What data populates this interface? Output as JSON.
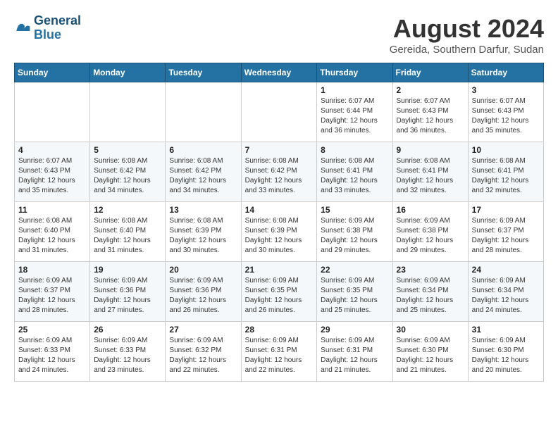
{
  "logo": {
    "line1": "General",
    "line2": "Blue"
  },
  "title": "August 2024",
  "location": "Gereida, Southern Darfur, Sudan",
  "weekdays": [
    "Sunday",
    "Monday",
    "Tuesday",
    "Wednesday",
    "Thursday",
    "Friday",
    "Saturday"
  ],
  "weeks": [
    [
      {
        "day": "",
        "info": ""
      },
      {
        "day": "",
        "info": ""
      },
      {
        "day": "",
        "info": ""
      },
      {
        "day": "",
        "info": ""
      },
      {
        "day": "1",
        "info": "Sunrise: 6:07 AM\nSunset: 6:44 PM\nDaylight: 12 hours\nand 36 minutes."
      },
      {
        "day": "2",
        "info": "Sunrise: 6:07 AM\nSunset: 6:43 PM\nDaylight: 12 hours\nand 36 minutes."
      },
      {
        "day": "3",
        "info": "Sunrise: 6:07 AM\nSunset: 6:43 PM\nDaylight: 12 hours\nand 35 minutes."
      }
    ],
    [
      {
        "day": "4",
        "info": "Sunrise: 6:07 AM\nSunset: 6:43 PM\nDaylight: 12 hours\nand 35 minutes."
      },
      {
        "day": "5",
        "info": "Sunrise: 6:08 AM\nSunset: 6:42 PM\nDaylight: 12 hours\nand 34 minutes."
      },
      {
        "day": "6",
        "info": "Sunrise: 6:08 AM\nSunset: 6:42 PM\nDaylight: 12 hours\nand 34 minutes."
      },
      {
        "day": "7",
        "info": "Sunrise: 6:08 AM\nSunset: 6:42 PM\nDaylight: 12 hours\nand 33 minutes."
      },
      {
        "day": "8",
        "info": "Sunrise: 6:08 AM\nSunset: 6:41 PM\nDaylight: 12 hours\nand 33 minutes."
      },
      {
        "day": "9",
        "info": "Sunrise: 6:08 AM\nSunset: 6:41 PM\nDaylight: 12 hours\nand 32 minutes."
      },
      {
        "day": "10",
        "info": "Sunrise: 6:08 AM\nSunset: 6:41 PM\nDaylight: 12 hours\nand 32 minutes."
      }
    ],
    [
      {
        "day": "11",
        "info": "Sunrise: 6:08 AM\nSunset: 6:40 PM\nDaylight: 12 hours\nand 31 minutes."
      },
      {
        "day": "12",
        "info": "Sunrise: 6:08 AM\nSunset: 6:40 PM\nDaylight: 12 hours\nand 31 minutes."
      },
      {
        "day": "13",
        "info": "Sunrise: 6:08 AM\nSunset: 6:39 PM\nDaylight: 12 hours\nand 30 minutes."
      },
      {
        "day": "14",
        "info": "Sunrise: 6:08 AM\nSunset: 6:39 PM\nDaylight: 12 hours\nand 30 minutes."
      },
      {
        "day": "15",
        "info": "Sunrise: 6:09 AM\nSunset: 6:38 PM\nDaylight: 12 hours\nand 29 minutes."
      },
      {
        "day": "16",
        "info": "Sunrise: 6:09 AM\nSunset: 6:38 PM\nDaylight: 12 hours\nand 29 minutes."
      },
      {
        "day": "17",
        "info": "Sunrise: 6:09 AM\nSunset: 6:37 PM\nDaylight: 12 hours\nand 28 minutes."
      }
    ],
    [
      {
        "day": "18",
        "info": "Sunrise: 6:09 AM\nSunset: 6:37 PM\nDaylight: 12 hours\nand 28 minutes."
      },
      {
        "day": "19",
        "info": "Sunrise: 6:09 AM\nSunset: 6:36 PM\nDaylight: 12 hours\nand 27 minutes."
      },
      {
        "day": "20",
        "info": "Sunrise: 6:09 AM\nSunset: 6:36 PM\nDaylight: 12 hours\nand 26 minutes."
      },
      {
        "day": "21",
        "info": "Sunrise: 6:09 AM\nSunset: 6:35 PM\nDaylight: 12 hours\nand 26 minutes."
      },
      {
        "day": "22",
        "info": "Sunrise: 6:09 AM\nSunset: 6:35 PM\nDaylight: 12 hours\nand 25 minutes."
      },
      {
        "day": "23",
        "info": "Sunrise: 6:09 AM\nSunset: 6:34 PM\nDaylight: 12 hours\nand 25 minutes."
      },
      {
        "day": "24",
        "info": "Sunrise: 6:09 AM\nSunset: 6:34 PM\nDaylight: 12 hours\nand 24 minutes."
      }
    ],
    [
      {
        "day": "25",
        "info": "Sunrise: 6:09 AM\nSunset: 6:33 PM\nDaylight: 12 hours\nand 24 minutes."
      },
      {
        "day": "26",
        "info": "Sunrise: 6:09 AM\nSunset: 6:33 PM\nDaylight: 12 hours\nand 23 minutes."
      },
      {
        "day": "27",
        "info": "Sunrise: 6:09 AM\nSunset: 6:32 PM\nDaylight: 12 hours\nand 22 minutes."
      },
      {
        "day": "28",
        "info": "Sunrise: 6:09 AM\nSunset: 6:31 PM\nDaylight: 12 hours\nand 22 minutes."
      },
      {
        "day": "29",
        "info": "Sunrise: 6:09 AM\nSunset: 6:31 PM\nDaylight: 12 hours\nand 21 minutes."
      },
      {
        "day": "30",
        "info": "Sunrise: 6:09 AM\nSunset: 6:30 PM\nDaylight: 12 hours\nand 21 minutes."
      },
      {
        "day": "31",
        "info": "Sunrise: 6:09 AM\nSunset: 6:30 PM\nDaylight: 12 hours\nand 20 minutes."
      }
    ]
  ]
}
